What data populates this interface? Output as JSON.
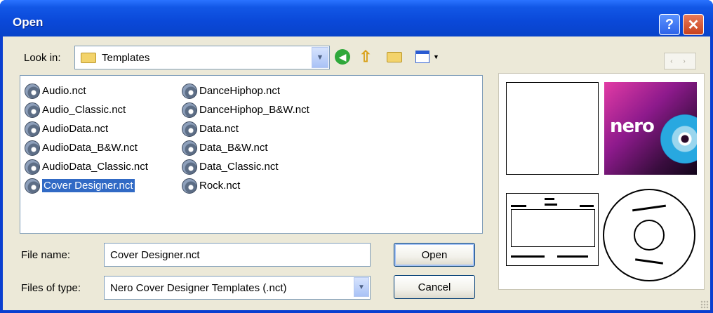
{
  "window": {
    "title": "Open",
    "help_label": "?",
    "close_label": "✕"
  },
  "lookin": {
    "label": "Look in:",
    "value": "Templates"
  },
  "toolbar": {
    "icons": [
      "back-icon",
      "up-folder-icon",
      "new-folder-icon",
      "views-menu-icon"
    ]
  },
  "files": {
    "column1": [
      {
        "name": "Audio.nct",
        "selected": false
      },
      {
        "name": "Audio_Classic.nct",
        "selected": false
      },
      {
        "name": "AudioData.nct",
        "selected": false
      },
      {
        "name": "AudioData_B&W.nct",
        "selected": false
      },
      {
        "name": "AudioData_Classic.nct",
        "selected": false
      },
      {
        "name": "Cover Designer.nct",
        "selected": true
      }
    ],
    "column2": [
      {
        "name": "DanceHiphop.nct",
        "selected": false
      },
      {
        "name": "DanceHiphop_B&W.nct",
        "selected": false
      },
      {
        "name": "Data.nct",
        "selected": false
      },
      {
        "name": "Data_B&W.nct",
        "selected": false
      },
      {
        "name": "Data_Classic.nct",
        "selected": false
      },
      {
        "name": "Rock.nct",
        "selected": false
      }
    ]
  },
  "preview": {
    "nav_label": "‹ ›",
    "nero_text": "nero"
  },
  "filename": {
    "label": "File name:",
    "value": "Cover Designer.nct"
  },
  "filetype": {
    "label": "Files of type:",
    "value": "Nero Cover Designer Templates (.nct)"
  },
  "buttons": {
    "open": "Open",
    "cancel": "Cancel"
  },
  "colors": {
    "selection": "#316ac5",
    "titlebar": "#0a48d8",
    "dialog_bg": "#ece9d8"
  }
}
